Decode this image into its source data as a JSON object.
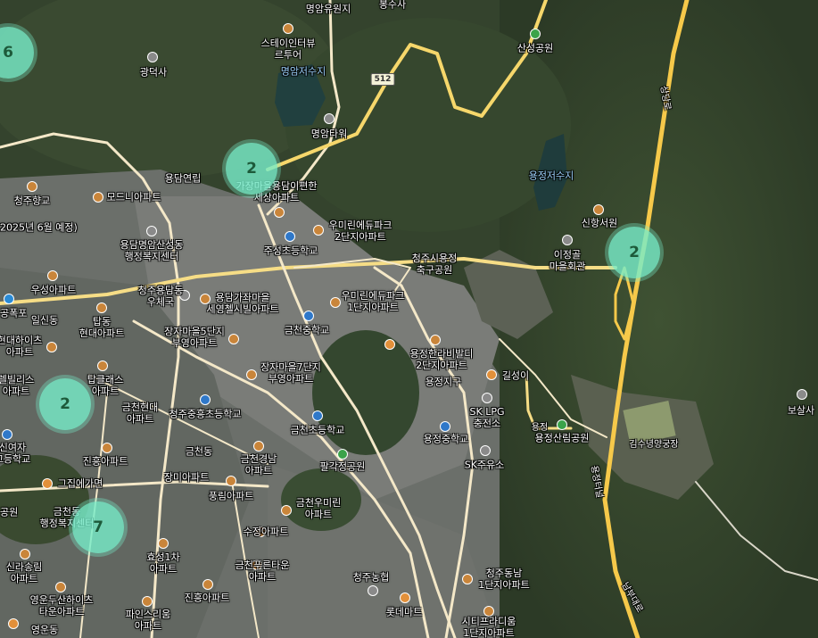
{
  "map": {
    "route_shield": "512",
    "clusters": [
      {
        "id": "c1",
        "count": "6"
      },
      {
        "id": "c2",
        "count": "2"
      },
      {
        "id": "c3",
        "count": "2"
      },
      {
        "id": "c4",
        "count": "2"
      },
      {
        "id": "c5",
        "count": "7"
      }
    ],
    "labels": {
      "myeongam_resort": "명암유원지",
      "bongsusa": "봉수사",
      "sancheong_park": "산성공원",
      "stay_interview": "스테이인터뷰\n르투어",
      "myeongam_reservoir": "명암저수지",
      "gwangdeoksa": "광덕사",
      "myeongam_tower": "명암타워",
      "yongdam_yeonrip": "용담연립",
      "yongjeong_reservoir": "용정저수지",
      "cheongju_hyanggyo": "청주향교",
      "modeuni_apt": "모드니아파트",
      "yongdam_ipyeonhan": "가장마을용담이편한\n세상아파트",
      "urimean_park2": "우미린에듀파크\n2단지아파트",
      "sinhang_seowon": "신항서원",
      "completion_2025": "2025년 6월 예정)",
      "yongdam_center": "용담명암산성동\n행정복지센터",
      "jusung_school": "주성초등학교",
      "yongjeong_field": "청주시용정\n축구공원",
      "ijeonggol_hall": "이정골\n마을회관",
      "woosung_apt": "우성아파트",
      "yongdam_post": "청주용담동\n우체국",
      "sewonapt": "용담가좌마을\n세영첼시빌아파트",
      "urimean_park1": "우미린에듀파크\n1단지아파트",
      "gongpok": "공폭포",
      "ilsin": "일신동",
      "tapdong_hyundai": "탑동\n현대아파트",
      "jangju5": "장자마을5단지\n부영아파트",
      "geumcheon_middle": "금천중학교",
      "hyundai_heights": "현대하이츠\n아파트",
      "hanbit": "용정한라비발디\n2단지아파트",
      "jangju7": "장자마을7단지\n부영아파트",
      "yongjeong_district": "용정지구",
      "gilseongi": "길성이",
      "gilville": "렐빌리스\n아파트",
      "tapclass": "탑클래스\n아파트",
      "geumcheon_hyundai": "금천현대\n아파트",
      "yongjeong_elem": "청주중흥초등학교",
      "sk_lpg": "SK LPG\n충전소",
      "geumcheon_elem": "금천초등학교",
      "yongjeong_middle": "용정중학교",
      "yongjeong_forest": "용정산림공원",
      "gimsunyeong": "김수녕양궁장",
      "boseungsa": "보살사",
      "sinyeo": "신여자\n고등학교",
      "jinheung_apt": "진흥아파트",
      "geumcheon_dong": "금천동",
      "geumcheon_gyeongnam": "금천경남\n아파트",
      "sk_gas": "SK주유소",
      "palgakjeong": "팔각정공원",
      "jangmi_apt": "장미아파트",
      "pungrim_apt": "풍림아파트",
      "myeonga": "명아",
      "geumcheon_center": "금천동\n행정복지센터",
      "hapjip": "그집에가면",
      "geumcheon_urimean": "금천우미린\n아파트",
      "gongwon": "공원",
      "sujeong_apt": "수정아파트",
      "hyoseong1": "효성1차\n아파트",
      "sinra_apt": "신라송림\n아파트",
      "geumcheon_tower": "금천푸른타운\n아파트",
      "cheongju_nonghyup": "청주농협",
      "cheongju_dongnam": "청주동남\n1단지아파트",
      "yeongun": "영운두산하이츠\n타운아파트",
      "jinheung_apt2": "진흥아파트",
      "paman": "파인스리움\n아파트",
      "lotte_mart": "롯데마트",
      "city_prime": "시티프라디움\n1단지아파트",
      "yeongun_dong": "영운동",
      "yongjeong_ro": "용정터널",
      "sangdang_ro": "상당로",
      "nambu_ro": "남부대로",
      "yongjeong": "용정"
    }
  }
}
